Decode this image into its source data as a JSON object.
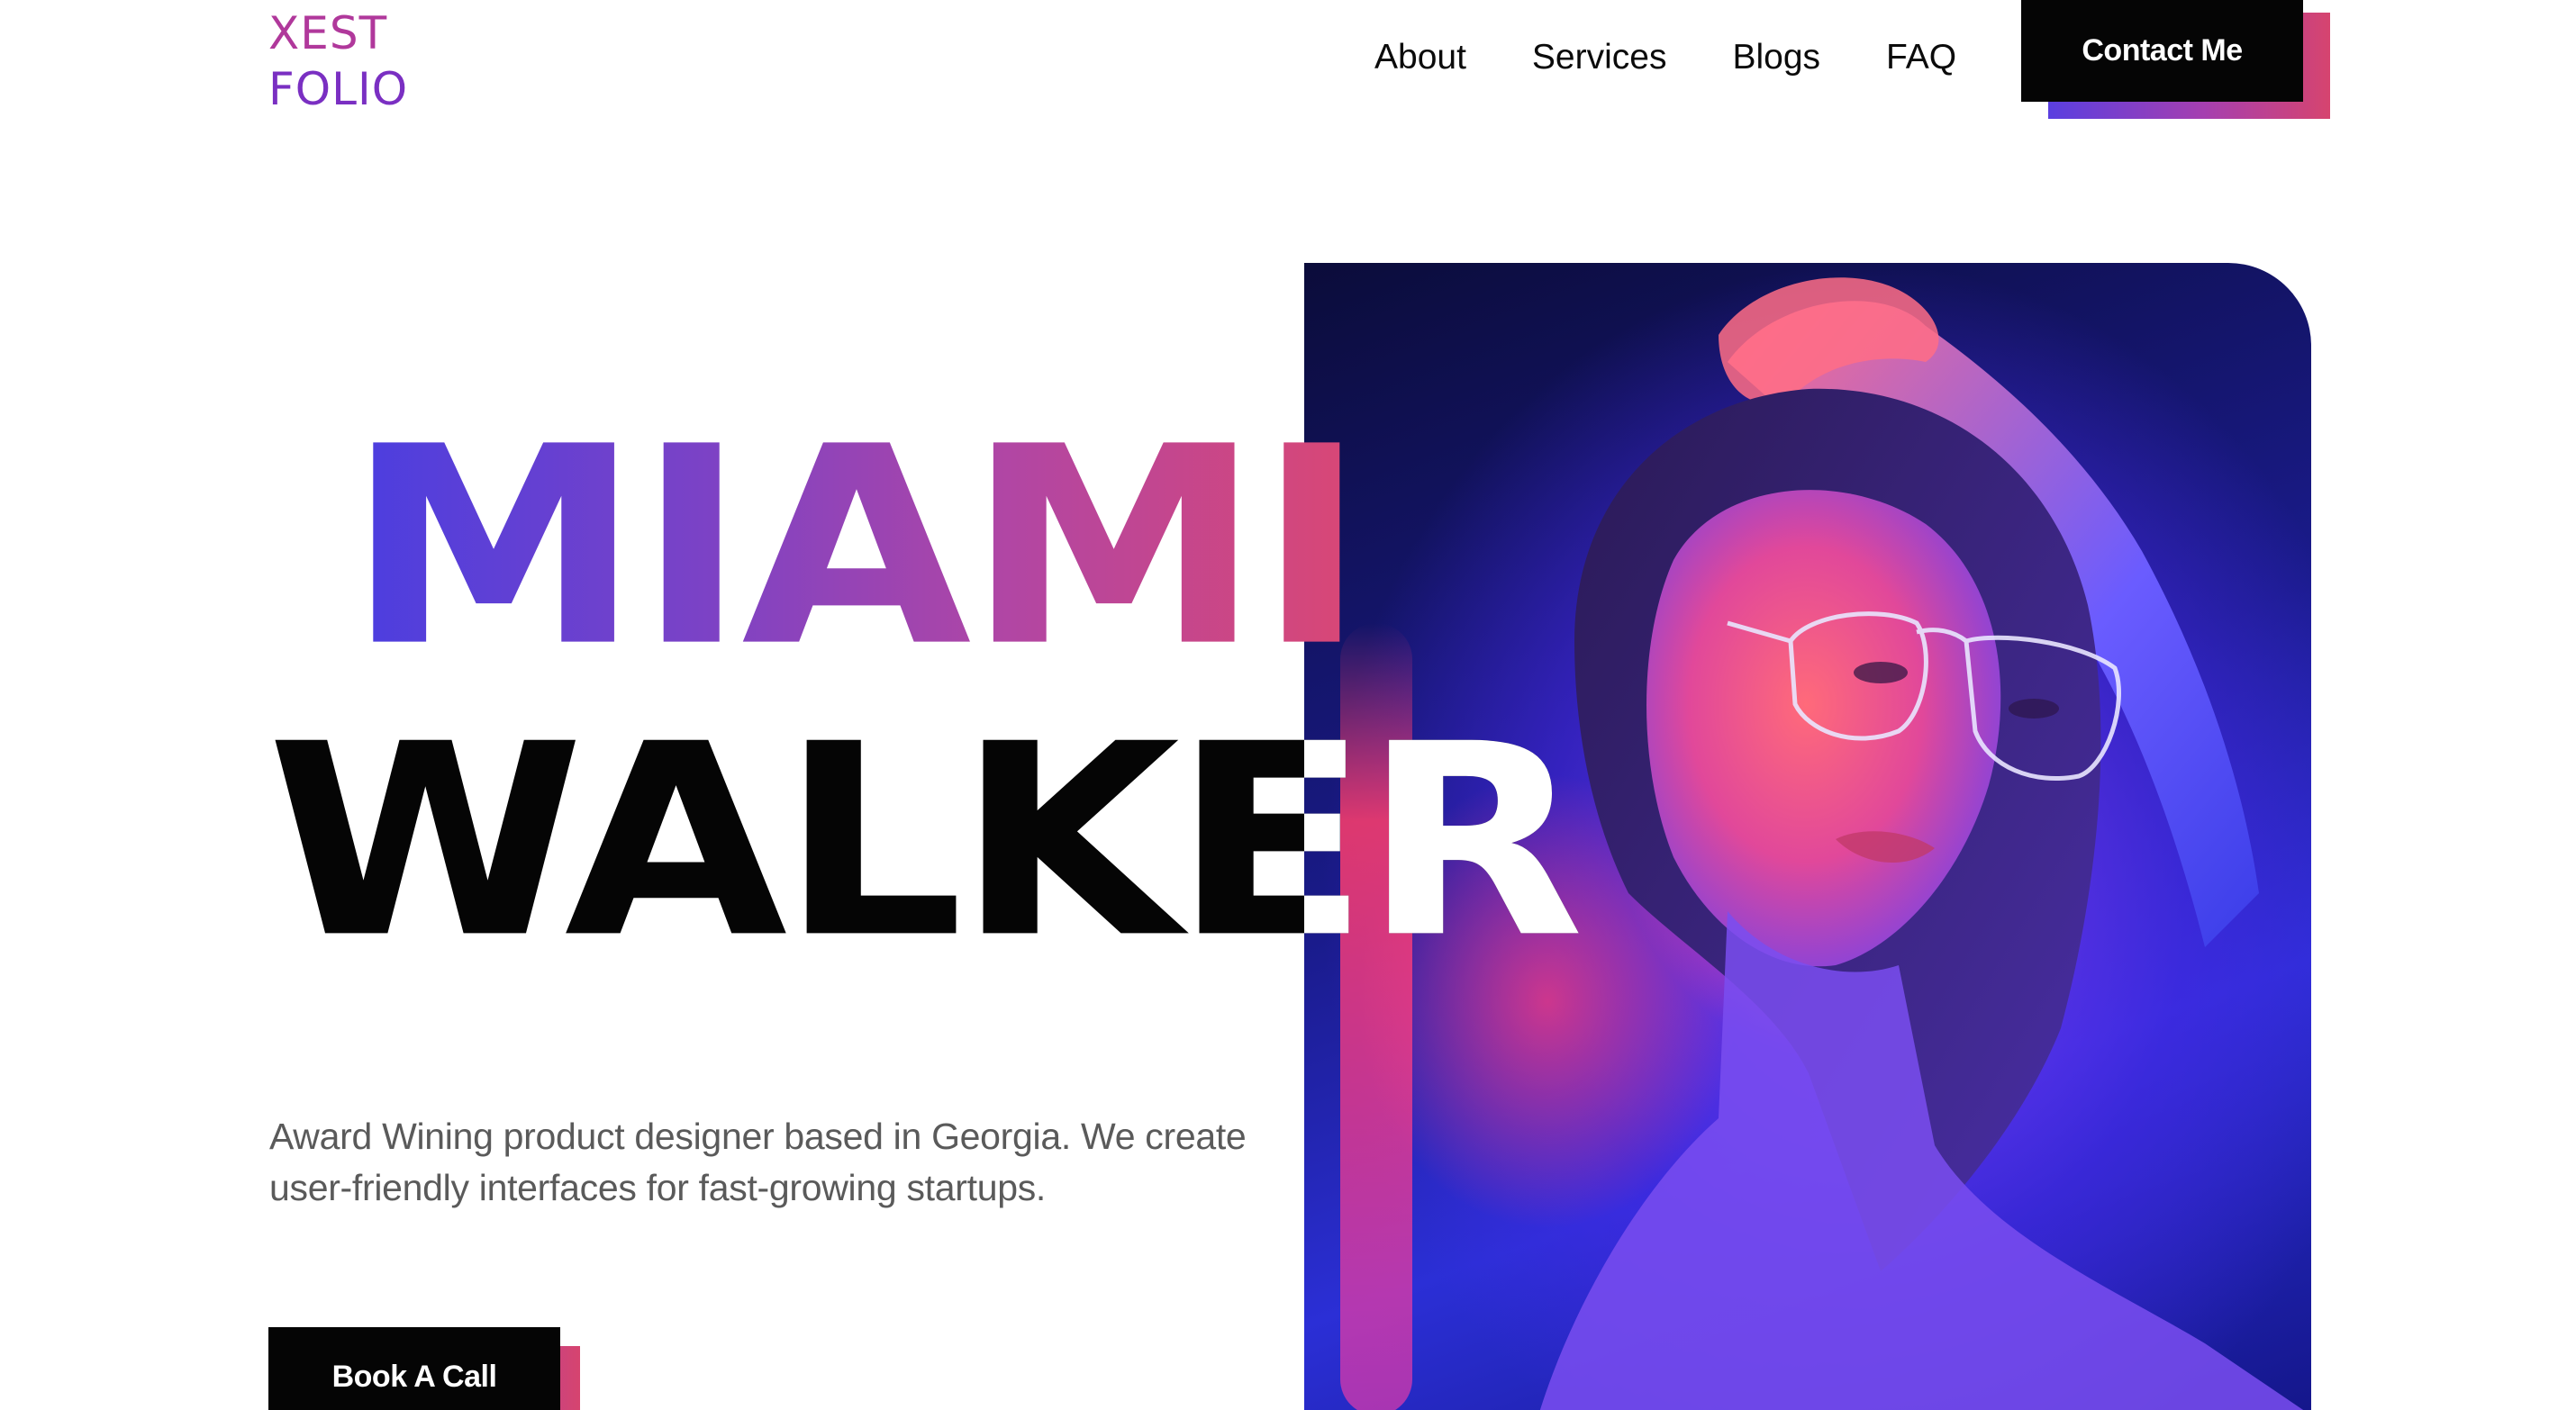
{
  "brand": {
    "line1": "XEST",
    "line2": "FOLIO"
  },
  "nav": {
    "items": [
      {
        "label": "About"
      },
      {
        "label": "Services"
      },
      {
        "label": "Blogs"
      },
      {
        "label": "FAQ"
      }
    ],
    "contact_label": "Contact Me"
  },
  "hero": {
    "first_name": "MIAMI",
    "last_name": "WALKER",
    "tagline": "Award Wining product designer based in Georgia. We create user-friendly interfaces for fast-growing startups.",
    "cta_label": "Book A Call"
  },
  "colors": {
    "gradient_start": "#4a3ee0",
    "gradient_end": "#da4774",
    "button_bg": "#050505"
  }
}
